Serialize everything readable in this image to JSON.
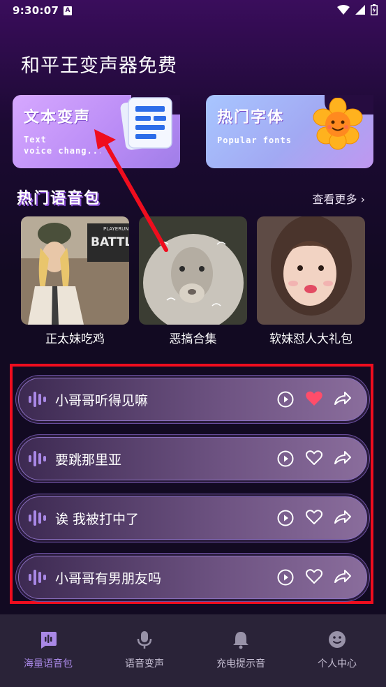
{
  "status_bar": {
    "time": "9:30:07",
    "notif_badge": "A"
  },
  "page_title": "和平王变声器免费",
  "cards": [
    {
      "title": "文本变声",
      "subtitle_line1": "Text",
      "subtitle_line2": "voice chang..."
    },
    {
      "title": "热门字体",
      "subtitle": "Popular fonts"
    }
  ],
  "section": {
    "title": "热门语音包",
    "more": "查看更多 ›"
  },
  "packs": [
    {
      "label": "正太妹吃鸡"
    },
    {
      "label": "恶搞合集"
    },
    {
      "label": "软妹怼人大礼包"
    }
  ],
  "sounds": [
    {
      "name": "小哥哥听得见嘛",
      "liked": true
    },
    {
      "name": "要跳那里亚",
      "liked": false
    },
    {
      "name": "诶 我被打中了",
      "liked": false
    },
    {
      "name": "小哥哥有男朋友吗",
      "liked": false
    }
  ],
  "nav": [
    {
      "label": "海量语音包",
      "active": true,
      "icon": "voice-pack-icon"
    },
    {
      "label": "语音变声",
      "active": false,
      "icon": "microphone-icon"
    },
    {
      "label": "充电提示音",
      "active": false,
      "icon": "bell-icon"
    },
    {
      "label": "个人中心",
      "active": false,
      "icon": "smiley-icon"
    }
  ],
  "colors": {
    "accent": "#a988e6",
    "highlight_box": "#ef0d1e",
    "heart": "#ff4d6a"
  }
}
